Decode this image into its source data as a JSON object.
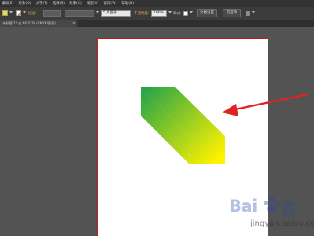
{
  "menubar": {
    "items": [
      "编辑(E)",
      "对象(O)",
      "文字(T)",
      "选择(S)",
      "效果(C)",
      "视图(V)",
      "窗口(W)",
      "帮助(H)"
    ]
  },
  "controlbar": {
    "stroke_label": "描边:",
    "stroke_style": "5 点圆形",
    "opacity_label": "不透明度:",
    "opacity_value": "100%",
    "style_label": "样式:",
    "doc_setup_button": "文档设置",
    "preferences_button": "首选项"
  },
  "document_tab": {
    "label": "未标题-1* @ 66.67% (CMYK/预览)",
    "close": "×"
  },
  "watermark": {
    "brand": "Bai",
    "brand_suffix": "百",
    "url": "jingyan.baidu.com"
  },
  "colors": {
    "gradient_start": "#1fa24a",
    "gradient_end": "#fff200",
    "arrow": "#e02222",
    "artboard_border": "#c11b1b",
    "canvas_bg": "#535353"
  }
}
